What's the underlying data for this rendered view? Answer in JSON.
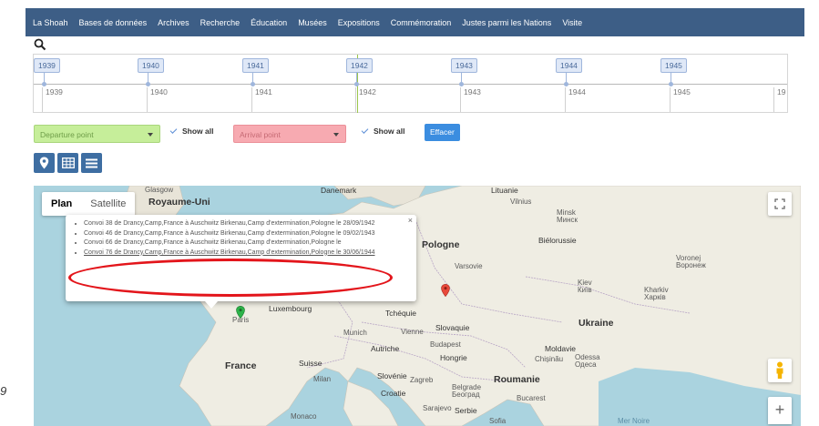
{
  "nav": [
    "La Shoah",
    "Bases de données",
    "Archives",
    "Recherche",
    "Éducation",
    "Musées",
    "Expositions",
    "Commémoration",
    "Justes parmi les Nations",
    "Visite"
  ],
  "timeline": {
    "items": [
      "1939",
      "1940",
      "1941",
      "1942",
      "1943",
      "1944",
      "1945"
    ],
    "axis_labels": [
      "1939",
      "1940",
      "1941",
      "1942",
      "1943",
      "1944",
      "1945",
      "19"
    ]
  },
  "filters": {
    "departure_placeholder": "Departure point",
    "show_all_1": "Show all",
    "arrival_placeholder": "Arrival point",
    "show_all_2": "Show all",
    "clear_label": "Effacer"
  },
  "map": {
    "type_plan": "Plan",
    "type_satellite": "Satellite",
    "zoom_plus": "+",
    "labels": {
      "glasgow": "Glasgow",
      "royaume_uni": "Royaume-Uni",
      "danemark": "Danemark",
      "lituanie": "Lituanie",
      "vilnius": "Vilnius",
      "minsk": "Minsk",
      "minsk_cyr": "Минск",
      "bielorussie": "Biélorussie",
      "pologne": "Pologne",
      "varsovie": "Varsovie",
      "voronej": "Voronej",
      "voronej_cyr": "Воронеж",
      "kiev": "Kiev",
      "kiev_cyr": "Київ",
      "kharkiv": "Kharkiv",
      "kharkiv_cyr": "Харків",
      "luxembourg": "Luxembourg",
      "tchequie": "Tchéquie",
      "paris": "Paris",
      "munich": "Munich",
      "vienne": "Vienne",
      "slovaquie": "Slovaquie",
      "ukraine": "Ukraine",
      "autriche": "Autriche",
      "budapest": "Budapest",
      "hongrie": "Hongrie",
      "moldavie": "Moldavie",
      "chisinau": "Chișinău",
      "odessa": "Odessa",
      "odessa_cyr": "Одеса",
      "france": "France",
      "suisse": "Suisse",
      "milan": "Milan",
      "slovenie": "Slovénie",
      "zagreb": "Zagreb",
      "croatie": "Croatie",
      "roumanie": "Roumanie",
      "belgrade": "Belgrade",
      "belgrade_cyr": "Београд",
      "bucarest": "Bucarest",
      "monaco": "Monaco",
      "sarajevo": "Sarajevo",
      "serbie": "Serbie",
      "sofia": "Sofia",
      "mer_noire": "Mer Noire"
    }
  },
  "popup": {
    "close": "×",
    "items": [
      "Convoi 38 de Drancy,Camp,France à Auschwitz Birkenau,Camp d'extermination,Pologne le 28/09/1942",
      "Convoi 46 de Drancy,Camp,France à Auschwitz Birkenau,Camp d'extermination,Pologne le 09/02/1943",
      "Convoi 66 de Drancy,Camp,France à Auschwitz Birkenau,Camp d'extermination,Pologne le",
      "Convoi 76 de Drancy,Camp,France à Auschwitz Birkenau,Camp d'extermination,Pologne le 30/06/1944"
    ]
  },
  "page_mark": "9",
  "colors": {
    "nav_bg": "#3d5e86",
    "departure": "#c6ee9a",
    "arrival": "#f7aab1",
    "button": "#3b8de0",
    "highlight": "#e3151b"
  }
}
